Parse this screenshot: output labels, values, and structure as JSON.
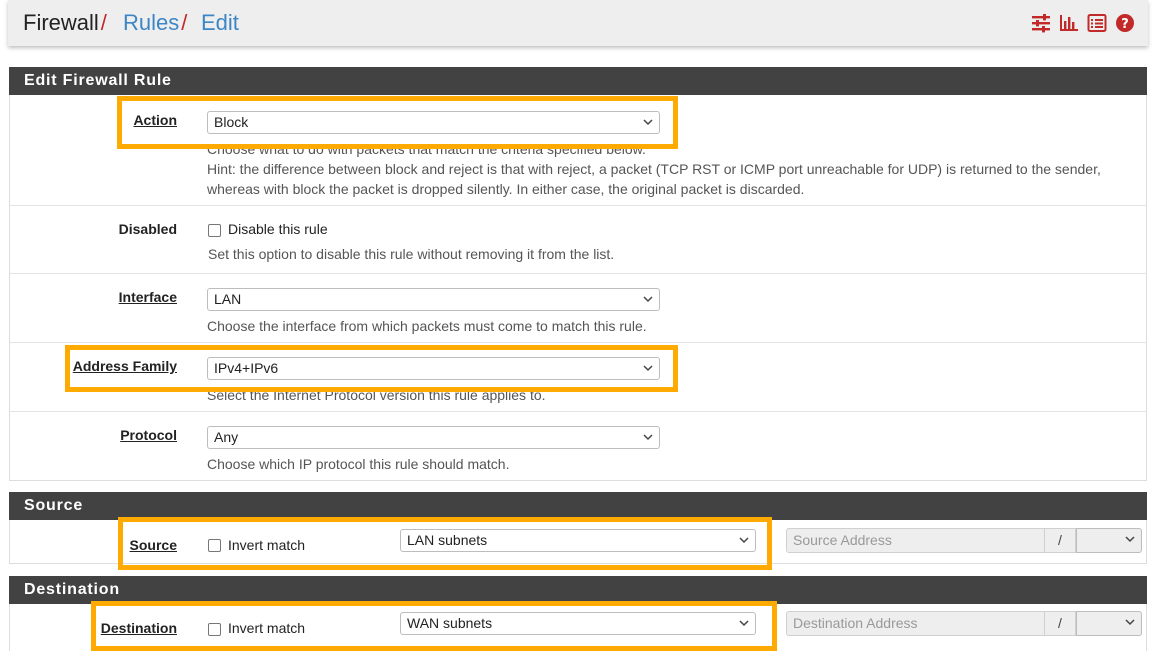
{
  "breadcrumb": {
    "part1": "Firewall",
    "part2": "Rules",
    "part3": "Edit",
    "separator": "/"
  },
  "header_icons": [
    "sliders-icon",
    "bar-chart-icon",
    "list-icon",
    "help-icon"
  ],
  "colors": {
    "accent_red": "#c22a2a",
    "link_blue": "#3d86c6",
    "panel_header": "#424242",
    "highlight": "#ffaa00"
  },
  "edit_section": {
    "title": "Edit Firewall Rule",
    "action": {
      "label": "Action",
      "value": "Block",
      "help1": "Choose what to do with packets that match the criteria specified below.",
      "help2": "Hint: the difference between block and reject is that with reject, a packet (TCP RST or ICMP port unreachable for UDP) is returned to the sender,",
      "help3": "whereas with block the packet is dropped silently. In either case, the original packet is discarded."
    },
    "disabled": {
      "label": "Disabled",
      "checkbox_label": "Disable this rule",
      "help": "Set this option to disable this rule without removing it from the list."
    },
    "interface": {
      "label": "Interface",
      "value": "LAN",
      "help": "Choose the interface from which packets must come to match this rule."
    },
    "address_family": {
      "label": "Address Family",
      "value": "IPv4+IPv6",
      "help": "Select the Internet Protocol version this rule applies to."
    },
    "protocol": {
      "label": "Protocol",
      "value": "Any",
      "help": "Choose which IP protocol this rule should match."
    }
  },
  "source_section": {
    "title": "Source",
    "label": "Source",
    "invert_label": "Invert match",
    "type_value": "LAN subnets",
    "address_placeholder": "Source Address",
    "slash": "/"
  },
  "destination_section": {
    "title": "Destination",
    "label": "Destination",
    "invert_label": "Invert match",
    "type_value": "WAN subnets",
    "address_placeholder": "Destination Address",
    "slash": "/"
  }
}
